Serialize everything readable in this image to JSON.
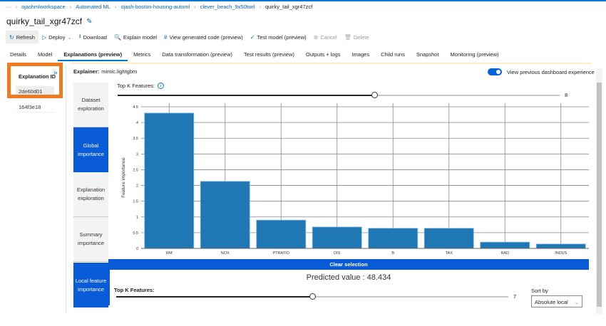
{
  "breadcrumb": [
    "···",
    "ojashmlworkspace",
    "Automated ML",
    "ojash-boston-housing-automl",
    "clever_beach_9x50twrl",
    "quirky_tail_xgr47zcf"
  ],
  "title": "quirky_tail_xgr47zcf",
  "toolbar": [
    {
      "label": "Refresh",
      "icon": "refresh-icon",
      "glyph": "↻"
    },
    {
      "label": "Deploy",
      "icon": "play-icon",
      "glyph": "▷",
      "caret": "⌄"
    },
    {
      "label": "Download",
      "icon": "download-icon",
      "glyph": "⭳"
    },
    {
      "label": "Explain model",
      "icon": "search-icon",
      "glyph": "🔍"
    },
    {
      "label": "View generated code (preview)",
      "icon": "hash-icon",
      "glyph": "#"
    },
    {
      "label": "Test model (preview)",
      "icon": "check-icon",
      "glyph": "✓"
    },
    {
      "label": "Cancel",
      "icon": "cancel-icon",
      "glyph": "⊗",
      "disabled": true
    },
    {
      "label": "Delete",
      "icon": "trash-icon",
      "glyph": "🗑",
      "disabled": true
    }
  ],
  "tabs": [
    "Details",
    "Model",
    "Explanations (preview)",
    "Metrics",
    "Data transformation (preview)",
    "Test results (preview)",
    "Outputs + logs",
    "Images",
    "Child runs",
    "Snapshot",
    "Monitoring (preview)"
  ],
  "active_tab": "Explanations (preview)",
  "explanation_panel": {
    "header": "Explanation ID",
    "ids": [
      "2de60d01",
      "164f3e18"
    ],
    "collapse_glyph": "»"
  },
  "explainer": {
    "label": "Explainer:",
    "value": "mimic.lightgbm"
  },
  "toggle": {
    "label": "View previous dashboard experience",
    "on": true
  },
  "side_nav": [
    "Dataset exploration",
    "Global importance",
    "Explanation exploration",
    "Summary importance",
    "Local feature importance"
  ],
  "selected_nav": [
    "Global importance",
    "Local feature importance"
  ],
  "top_k": {
    "label": "Top K Features:",
    "value": "8",
    "fraction": 0.58,
    "info_glyph": "i"
  },
  "chart_data": {
    "type": "bar",
    "title": "",
    "xlabel": "",
    "ylabel": "Feature importance",
    "categories": [
      "RM",
      "NOX",
      "PTRATIO",
      "DIS",
      "B",
      "TAX",
      "RAD",
      "INDUS"
    ],
    "values": [
      4.3,
      2.13,
      0.9,
      0.68,
      0.64,
      0.64,
      0.2,
      0.14
    ],
    "ylim": [
      0,
      4.5
    ],
    "yticks": [
      "0",
      "0.5",
      "1",
      "1.5",
      "2",
      "2.5",
      "3",
      "3.5",
      "4",
      "4.5"
    ],
    "grid": true,
    "color": "#1f77b4"
  },
  "clear_selection": "Clear selection",
  "predicted": "Predicted value : 48.434",
  "local_top_k": {
    "label": "Top K Features:",
    "value": "7",
    "fraction": 0.5
  },
  "sort_by": {
    "label": "Sort by",
    "value": "Absolute local",
    "caret": "⌄"
  }
}
